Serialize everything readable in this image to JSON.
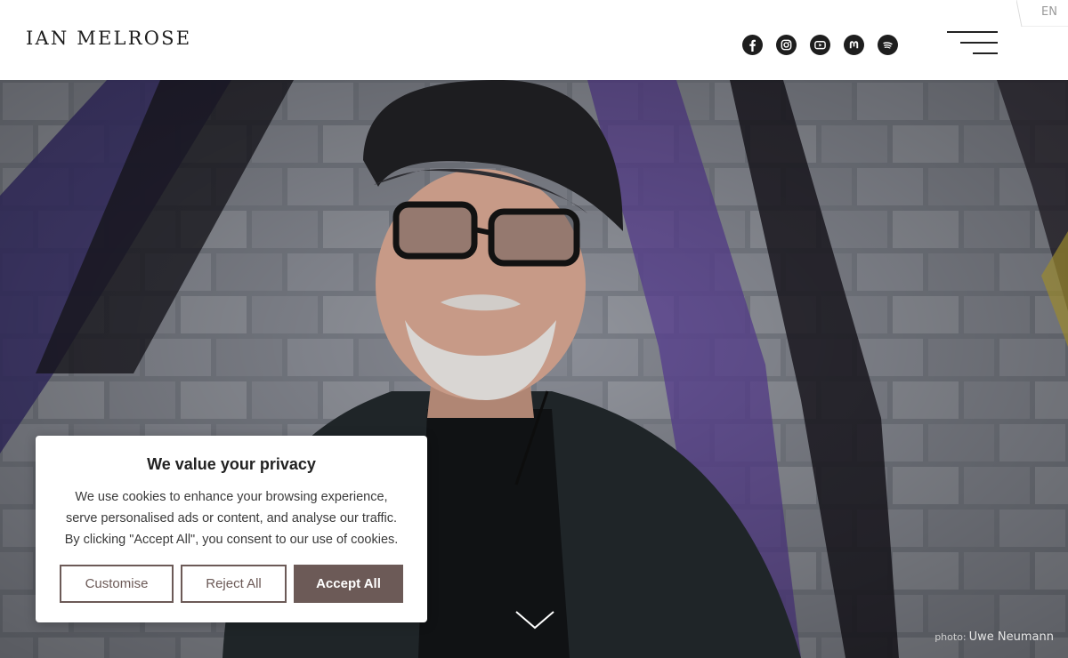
{
  "header": {
    "logo": "IAN MELROSE",
    "socials": [
      {
        "icon": "facebook-icon"
      },
      {
        "icon": "instagram-icon"
      },
      {
        "icon": "youtube-icon"
      },
      {
        "icon": "mastodon-icon"
      },
      {
        "icon": "spotify-icon"
      }
    ],
    "menu_icon": "hamburger-menu-icon",
    "language": "EN"
  },
  "hero": {
    "photo_credit_prefix": "photo:",
    "photo_credit_name": "Uwe Neumann",
    "scroll_icon": "chevron-down-icon"
  },
  "cookie_banner": {
    "title": "We value your privacy",
    "lines": [
      "We use cookies to enhance your browsing experience,",
      "serve personalised ads or content, and analyse our traffic.",
      "By clicking \"Accept All\", you consent to our use of cookies."
    ],
    "customise_label": "Customise",
    "reject_label": "Reject All",
    "accept_label": "Accept All"
  },
  "colors": {
    "accent": "#6c5a57",
    "icon": "#1e1e1e",
    "text": "#222222"
  }
}
